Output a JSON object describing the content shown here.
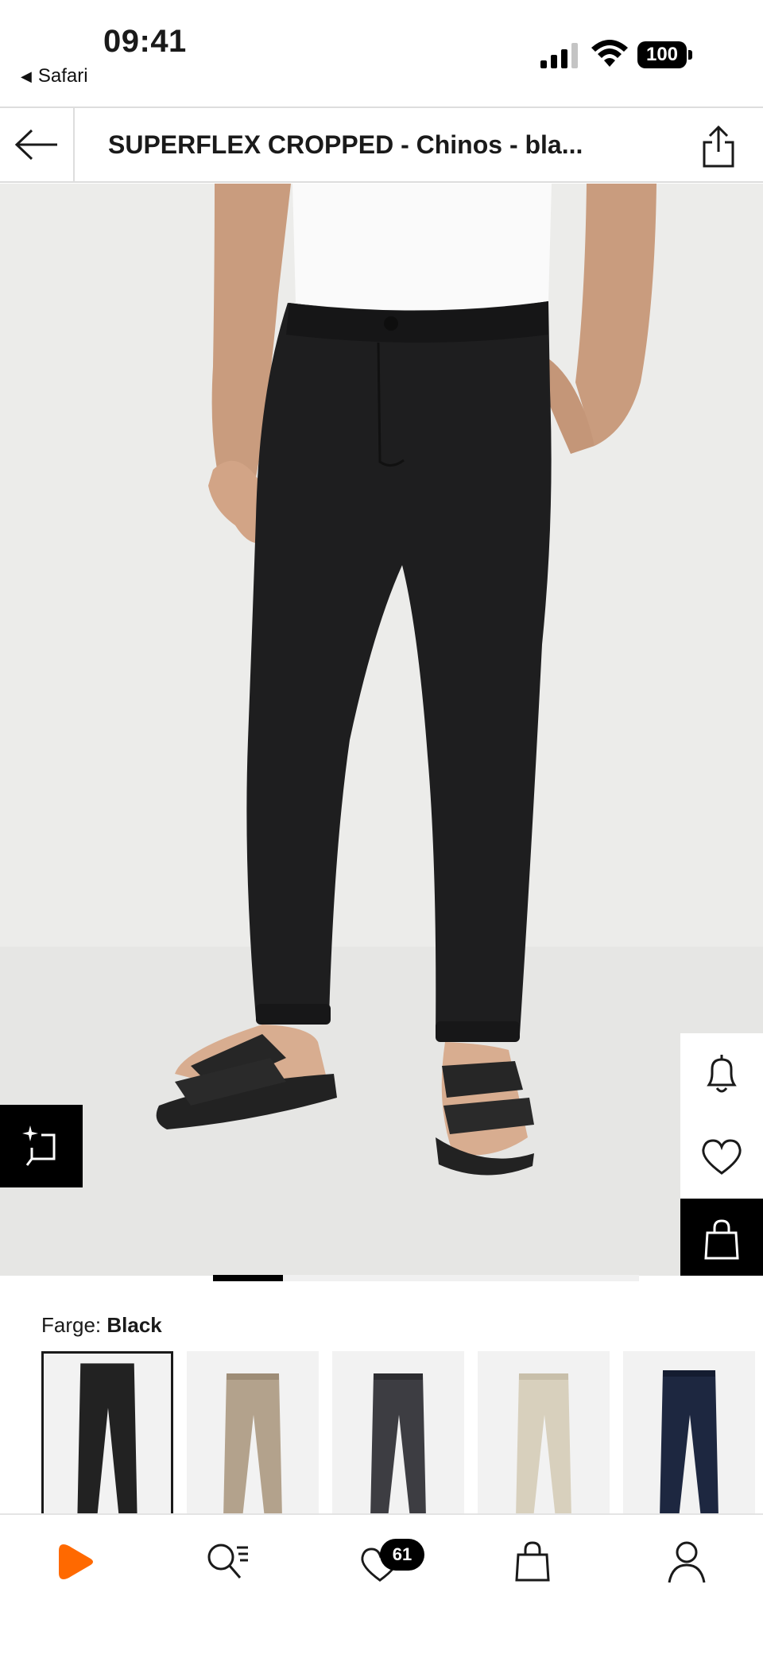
{
  "status_bar": {
    "time": "09:41",
    "back_app": "Safari",
    "battery": "100"
  },
  "header": {
    "title": "SUPERFLEX CROPPED  - Chinos - bla..."
  },
  "product": {
    "color_label": "Farge:",
    "color_value": "Black",
    "swatches": [
      {
        "name": "Black",
        "color": "#222222",
        "selected": true
      },
      {
        "name": "Beige",
        "color": "#b3a28c",
        "selected": false
      },
      {
        "name": "Dark grey",
        "color": "#3d3d42",
        "selected": false
      },
      {
        "name": "Cream",
        "color": "#d8d0bd",
        "selected": false
      },
      {
        "name": "Navy",
        "color": "#1d2740",
        "selected": false
      }
    ],
    "gallery_position": 0.17
  },
  "bottom_nav": {
    "items": [
      {
        "icon": "home-logo-icon"
      },
      {
        "icon": "search-icon"
      },
      {
        "icon": "heart-icon",
        "badge": "61"
      },
      {
        "icon": "bag-icon"
      },
      {
        "icon": "profile-icon"
      }
    ]
  },
  "colors": {
    "accent": "#ff6900",
    "dark": "#000000",
    "pants": "#1e1e1f",
    "background": "#ececea"
  }
}
